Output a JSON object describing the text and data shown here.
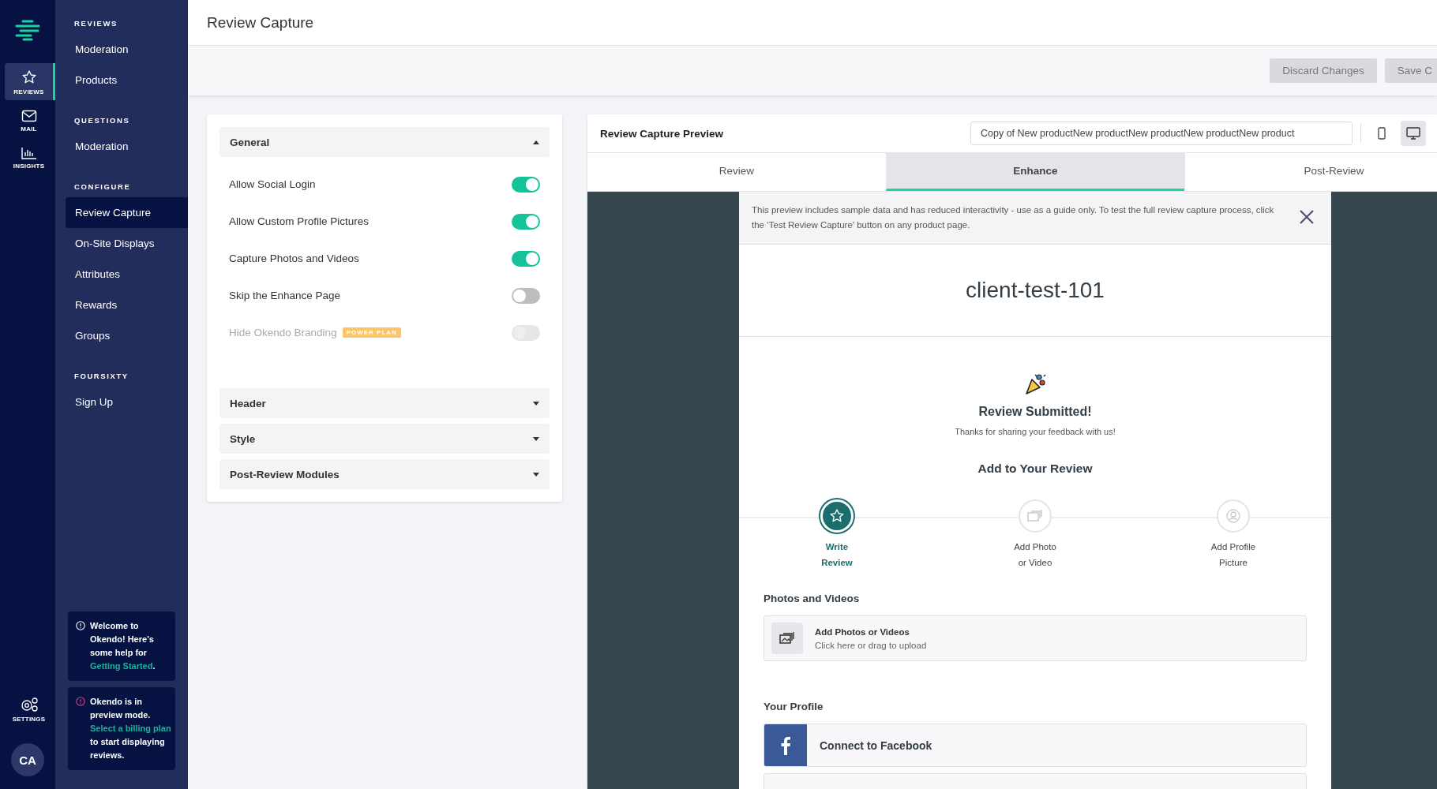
{
  "rail": {
    "items": [
      {
        "kind": "star",
        "label": "REVIEWS",
        "selected": true
      },
      {
        "kind": "mail",
        "label": "MAIL",
        "selected": false
      },
      {
        "kind": "chart",
        "label": "INSIGHTS",
        "selected": false
      }
    ],
    "settings": {
      "label": "SETTINGS"
    },
    "avatar": "CA"
  },
  "sidebar": {
    "sections": [
      {
        "heading": "REVIEWS",
        "items": [
          {
            "label": "Moderation",
            "selected": false
          },
          {
            "label": "Products",
            "selected": false
          }
        ]
      },
      {
        "heading": "QUESTIONS",
        "items": [
          {
            "label": "Moderation",
            "selected": false
          }
        ]
      },
      {
        "heading": "CONFIGURE",
        "items": [
          {
            "label": "Review Capture",
            "selected": true
          },
          {
            "label": "On-Site Displays",
            "selected": false
          },
          {
            "label": "Attributes",
            "selected": false
          },
          {
            "label": "Rewards",
            "selected": false
          },
          {
            "label": "Groups",
            "selected": false
          }
        ]
      },
      {
        "heading": "FOURSIXTY",
        "items": [
          {
            "label": "Sign Up",
            "selected": false
          }
        ]
      }
    ],
    "notices": [
      {
        "kind": "info",
        "text_before": "Welcome to Okendo! Here's some help for ",
        "link": "Getting Started",
        "text_after": "."
      },
      {
        "kind": "warning",
        "text_before": "Okendo is in preview mode. ",
        "link": "Select a billing plan",
        "text_after": " to start displaying reviews."
      }
    ]
  },
  "page": {
    "title": "Review Capture",
    "buttons": [
      {
        "label": "Discard Changes"
      },
      {
        "label": "Save C"
      }
    ]
  },
  "settings_panel": {
    "sections": [
      {
        "title": "General",
        "expanded": true,
        "settings": [
          {
            "label": "Allow Social Login",
            "on": true,
            "disabled": false
          },
          {
            "label": "Allow Custom Profile Pictures",
            "on": true,
            "disabled": false
          },
          {
            "label": "Capture Photos and Videos",
            "on": true,
            "disabled": false
          },
          {
            "label": "Skip the Enhance Page",
            "on": false,
            "disabled": false
          },
          {
            "label": "Hide Okendo Branding",
            "badge": "POWER PLAN",
            "on": false,
            "disabled": true
          }
        ]
      },
      {
        "title": "Header",
        "expanded": false
      },
      {
        "title": "Style",
        "expanded": false
      },
      {
        "title": "Post-Review Modules",
        "expanded": false
      }
    ]
  },
  "preview": {
    "title": "Review Capture Preview",
    "product_field": "Copy of New productNew productNew productNew productNew product",
    "devices": [
      {
        "kind": "mobile",
        "selected": false
      },
      {
        "kind": "desktop",
        "selected": true
      }
    ],
    "tabs": [
      {
        "label": "Review",
        "selected": false
      },
      {
        "label": "Enhance",
        "selected": true
      },
      {
        "label": "Post-Review",
        "selected": false
      }
    ],
    "notice": "This preview includes sample data and has reduced interactivity - use as a guide only. To test the full review capture process, click the ‘Test Review Capture’ button on any product page.",
    "product_name": "client-test-101",
    "submitted_title": "Review Submitted!",
    "submitted_text": "Thanks for sharing your feedback with us!",
    "add_heading": "Add to Your Review",
    "steps": [
      {
        "kind": "star",
        "label": "Write Review",
        "selected": true
      },
      {
        "kind": "photo",
        "label": "Add Photo or Video",
        "selected": false
      },
      {
        "kind": "profile",
        "label": "Add Profile Picture",
        "selected": false
      }
    ],
    "photos": {
      "heading": "Photos and Videos",
      "title": "Add Photos or Videos",
      "subtitle": "Click here or drag to upload"
    },
    "profile": {
      "heading": "Your Profile",
      "connect": "Connect to Facebook"
    }
  }
}
